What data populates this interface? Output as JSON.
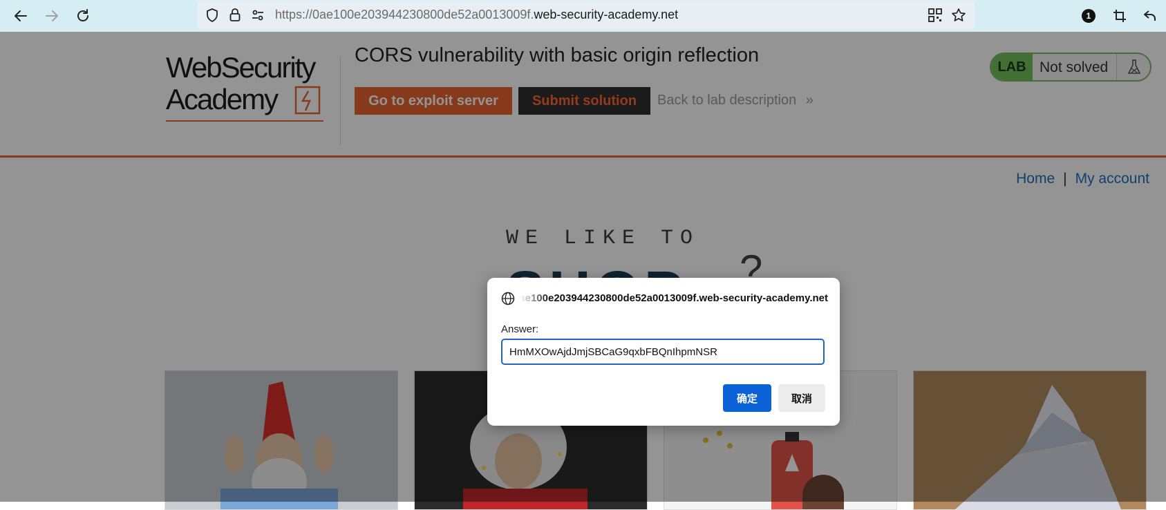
{
  "browser": {
    "url_prefix": "https://0ae100e203944230800de52a0013009f.",
    "url_domain": "web-security-academy.net",
    "extension_badge": "1",
    "icons": [
      "back-icon",
      "forward-icon",
      "reload-icon",
      "shield-icon",
      "lock-icon",
      "site-settings-icon",
      "qr-code-icon",
      "bookmark-star-icon",
      "extension-badge-icon",
      "crop-icon",
      "undo-icon"
    ]
  },
  "page": {
    "logo": {
      "line1": "WebSecurity",
      "line2": "Academy"
    },
    "lab_title": "CORS vulnerability with basic origin reflection",
    "exploit_button": "Go to exploit server",
    "submit_button": "Submit solution",
    "back_link": "Back to lab description",
    "back_chevrons": "»",
    "lab_badge": "LAB",
    "lab_status": "Not solved",
    "nav": {
      "home": "Home",
      "separator": "|",
      "account": "My account"
    },
    "hero_small": "WE LIKE TO",
    "hero_big": "SHOP",
    "hero_mark": "?",
    "accent_color": "#e7642f"
  },
  "dialog": {
    "origin": "0ae100e203944230800de52a0013009f.web-security-academy.net",
    "label": "Answer:",
    "input_value": "HmMXOwAjdJmjSBCaG9qxbFBQnIhpmNSR",
    "ok_label": "确定",
    "cancel_label": "取消",
    "ok_color": "#0b62d6"
  }
}
